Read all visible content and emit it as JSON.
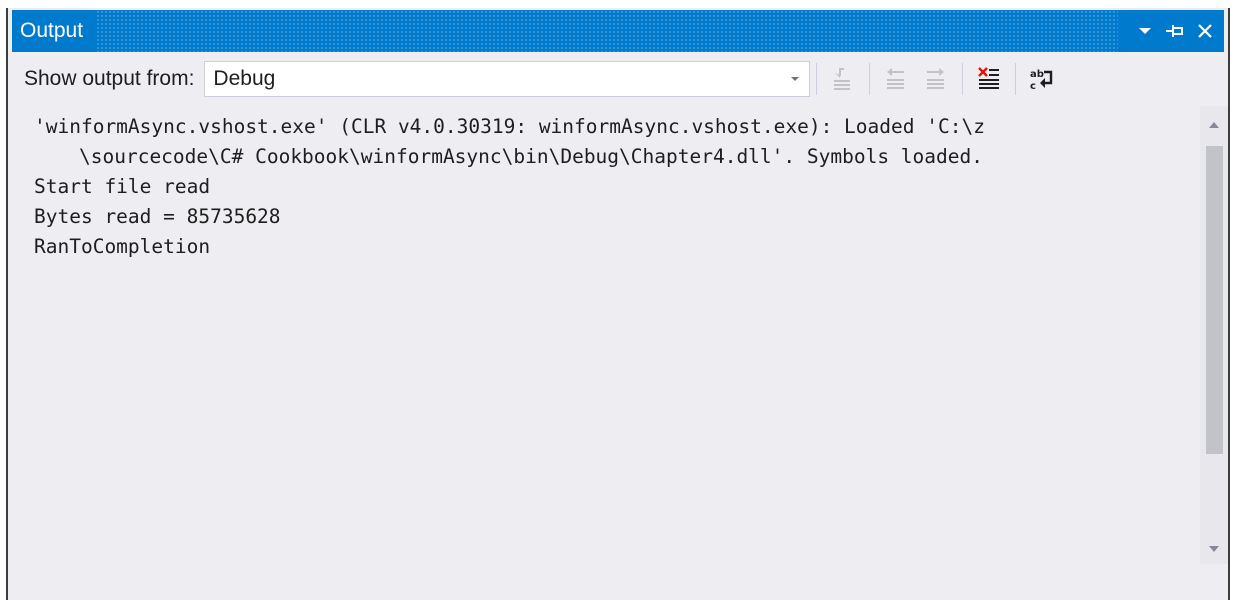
{
  "window": {
    "title": "Output"
  },
  "title_buttons": [
    {
      "name": "window-position-dropdown-icon"
    },
    {
      "name": "auto-hide-pin-icon"
    },
    {
      "name": "close-icon"
    }
  ],
  "toolbar": {
    "show_output_label": "Show output from:",
    "source_selected": "Debug",
    "buttons": [
      {
        "name": "find-message-in-code-icon",
        "enabled": false
      },
      {
        "name": "go-to-previous-message-icon",
        "enabled": false
      },
      {
        "name": "go-to-next-message-icon",
        "enabled": false
      },
      {
        "name": "clear-all-icon",
        "enabled": true
      },
      {
        "name": "toggle-word-wrap-icon",
        "enabled": true
      }
    ]
  },
  "output": {
    "lines": [
      "'winformAsync.vshost.exe' (CLR v4.0.30319: winformAsync.vshost.exe): Loaded 'C:\\z",
      "\\sourcecode\\C# Cookbook\\winformAsync\\bin\\Debug\\Chapter4.dll'. Symbols loaded.",
      "Start file read",
      "Bytes read = 85735628",
      "RanToCompletion"
    ]
  },
  "colors": {
    "accent": "#007acc",
    "panel_background": "#eeeef2",
    "text": "#1e1e1e",
    "disabled_icon": "#a2a4a5",
    "clear_icon_red": "#e51400"
  }
}
